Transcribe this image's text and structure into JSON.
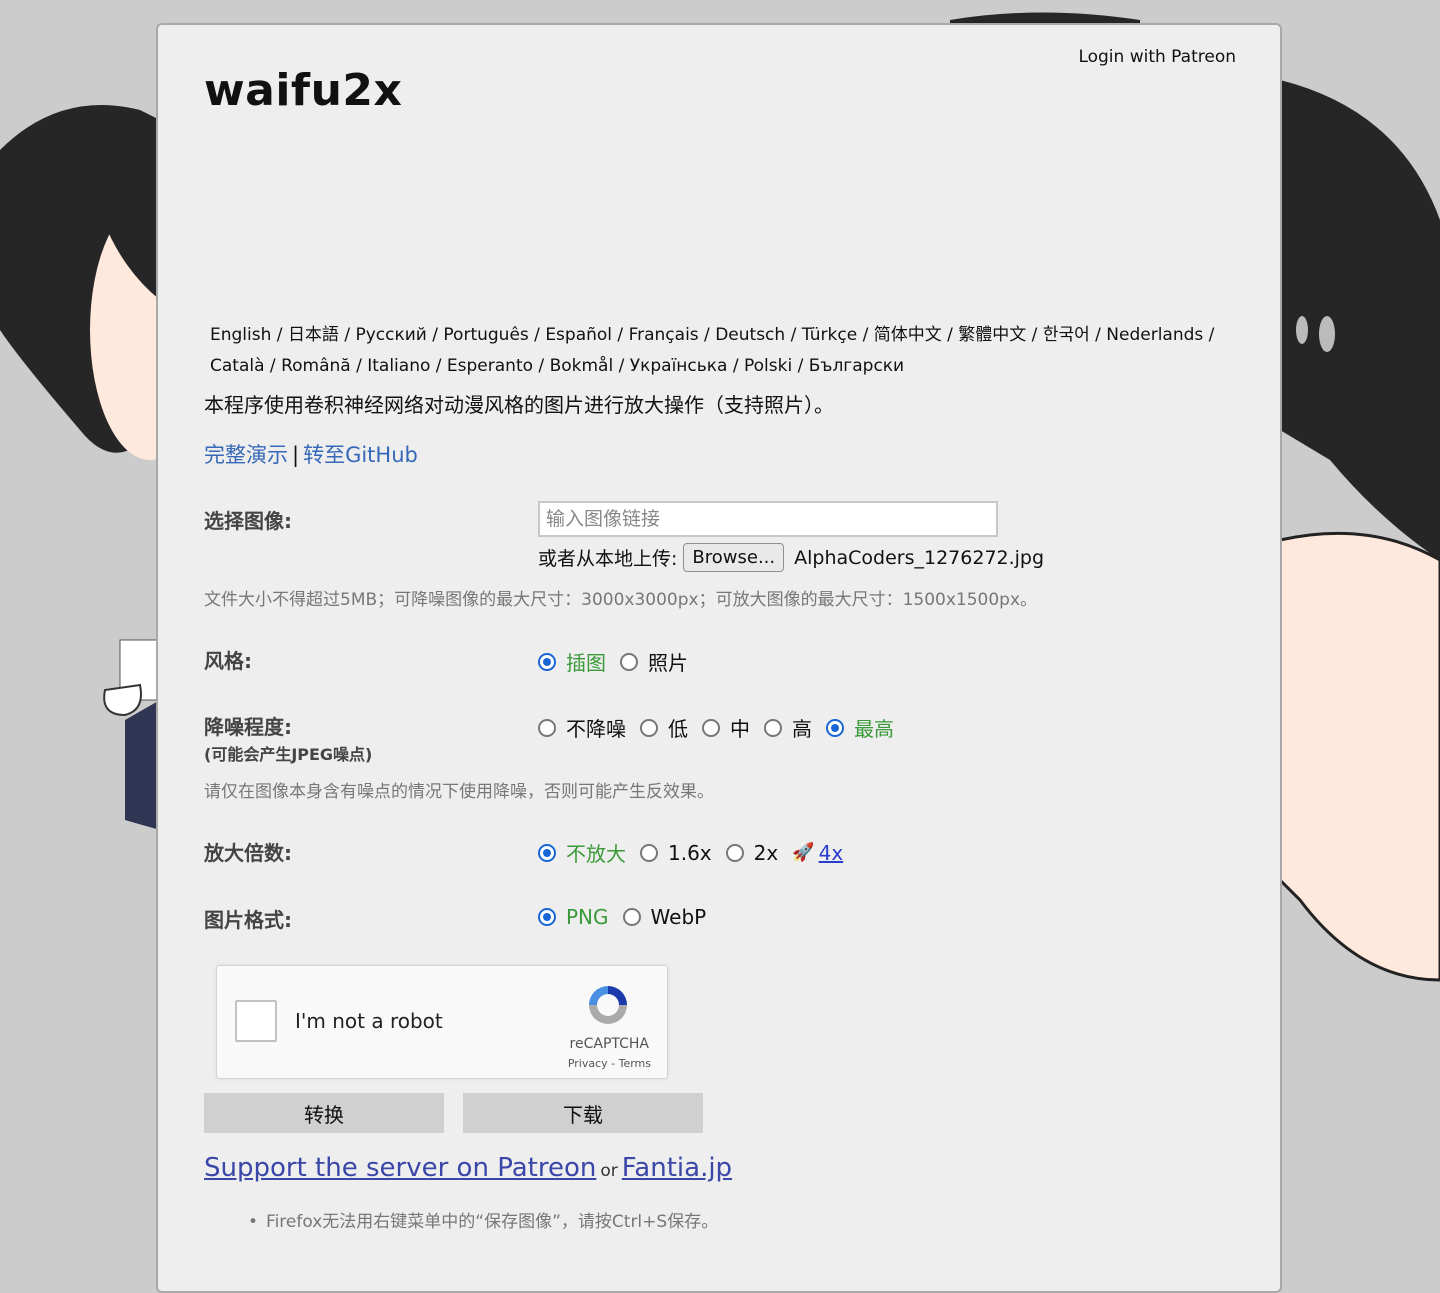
{
  "header": {
    "login_label": "Login with Patreon",
    "title": "waifu2x"
  },
  "languages": [
    "English",
    "日本語",
    "Русский",
    "Português",
    "Español",
    "Français",
    "Deutsch",
    "Türkçe",
    "简体中文",
    "繁體中文",
    "한국어",
    "Nederlands",
    "Català",
    "Română",
    "Italiano",
    "Esperanto",
    "Bokmål",
    "Українська",
    "Polski",
    "Български"
  ],
  "description": "本程序使用卷积神经网络对动漫风格的图片进行放大操作（支持照片）。",
  "links": {
    "demo": "完整演示",
    "separator": "|",
    "github": "转至GitHub"
  },
  "image_select": {
    "label": "选择图像:",
    "url_placeholder": "输入图像链接",
    "local_label": "或者从本地上传:",
    "browse_label": "Browse...",
    "file_name": "AlphaCoders_1276272.jpg",
    "note": "文件大小不得超过5MB；可降噪图像的最大尺寸：3000x3000px；可放大图像的最大尺寸：1500x1500px。"
  },
  "style": {
    "label": "风格:",
    "options": [
      "插图",
      "照片"
    ],
    "selected": "插图"
  },
  "noise": {
    "label": "降噪程度:",
    "sublabel": "(可能会产生JPEG噪点)",
    "options": [
      "不降噪",
      "低",
      "中",
      "高",
      "最高"
    ],
    "selected": "最高",
    "note": "请仅在图像本身含有噪点的情况下使用降噪，否则可能产生反效果。"
  },
  "scale": {
    "label": "放大倍数:",
    "options": [
      "不放大",
      "1.6x",
      "2x"
    ],
    "selected": "不放大",
    "link_4x": "4x"
  },
  "format": {
    "label": "图片格式:",
    "options": [
      "PNG",
      "WebP"
    ],
    "selected": "PNG"
  },
  "recaptcha": {
    "text": "I'm not a robot",
    "brand": "reCAPTCHA",
    "terms": "Privacy - Terms"
  },
  "actions": {
    "convert": "转换",
    "download": "下载"
  },
  "support": {
    "patreon": "Support the server on Patreon",
    "or": "or",
    "fantia": "Fantia.jp"
  },
  "tip": "Firefox无法用右键菜单中的“保存图像”，请按Ctrl+S保存。",
  "colors": {
    "selected_option": "#3a9a3a",
    "radio_accent": "#1a66d6",
    "link": "#3568b8"
  }
}
